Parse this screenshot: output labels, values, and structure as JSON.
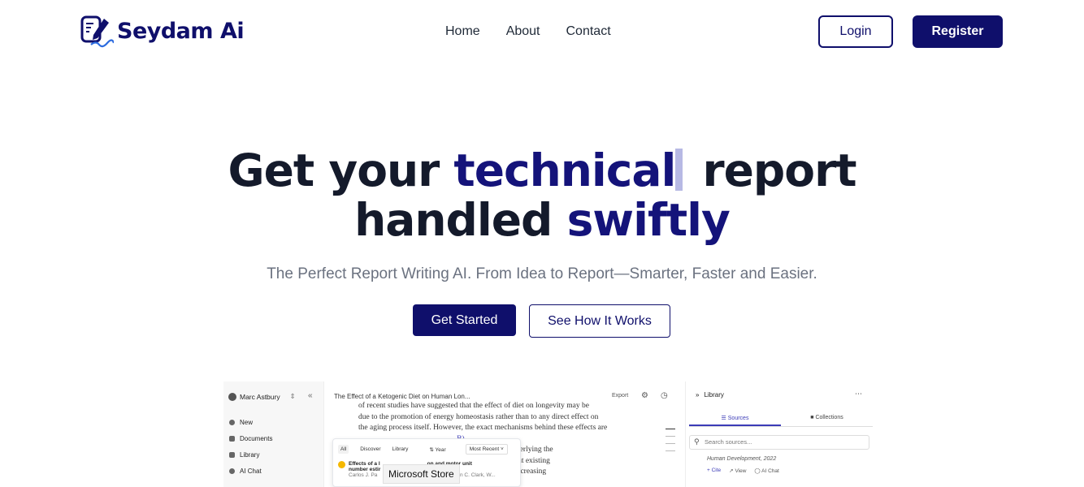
{
  "brand": {
    "name": "Seydam Ai",
    "logo_icon": "document-pen-icon",
    "color": "#0f0f6b"
  },
  "nav": {
    "links": [
      "Home",
      "About",
      "Contact"
    ],
    "login": "Login",
    "register": "Register"
  },
  "hero": {
    "title_part1": "Get your ",
    "title_accent1": "technical",
    "title_part2": " report",
    "title_part3": "handled ",
    "title_accent2": "swiftly",
    "subtitle": "The Perfect Report Writing AI. From Idea to Report—Smarter, Faster and Easier.",
    "cta_primary": "Get Started",
    "cta_secondary": "See How It Works"
  },
  "preview": {
    "user_name": "Marc Astbury",
    "collapse_glyph": "«",
    "side_nav": [
      "New",
      "Documents",
      "Library",
      "AI Chat"
    ],
    "doc_title": "The Effect of a Ketogenic Diet on Human Lon...",
    "export": "Export",
    "body_lines": [
      "of recent studies have suggested that the effect of diet on longevity may be",
      "due to the promotion of energy homeostasis rather than to any direct effect on",
      "the aging process itself. However, the exact mechanisms behind these effects are",
      "                                                   B).",
      "                                                   the mechanisms underlying the",
      "                                                   gevity in humans, but existing",
      "                                                   dietary pattern for increasing"
    ],
    "popup_tabs": [
      "All",
      "Discover",
      "Library"
    ],
    "popup_year": "Year",
    "popup_sort": "Most Recent",
    "popup_result_title": "Effects of a l",
    "popup_result_tail": "on and motor unit",
    "popup_result_line2": "number estir",
    "popup_authors": "Carlos J. Pa",
    "popup_authors_tail": "Brian C. Clark, W...",
    "tooltip": "Microsoft Store",
    "library_title": "Library",
    "library_tabs": [
      "Sources",
      "Collections"
    ],
    "search_placeholder": "Search sources...",
    "ref_journal": "Human Development, 2022",
    "ref_actions": [
      "Cite",
      "View",
      "AI Chat"
    ]
  }
}
